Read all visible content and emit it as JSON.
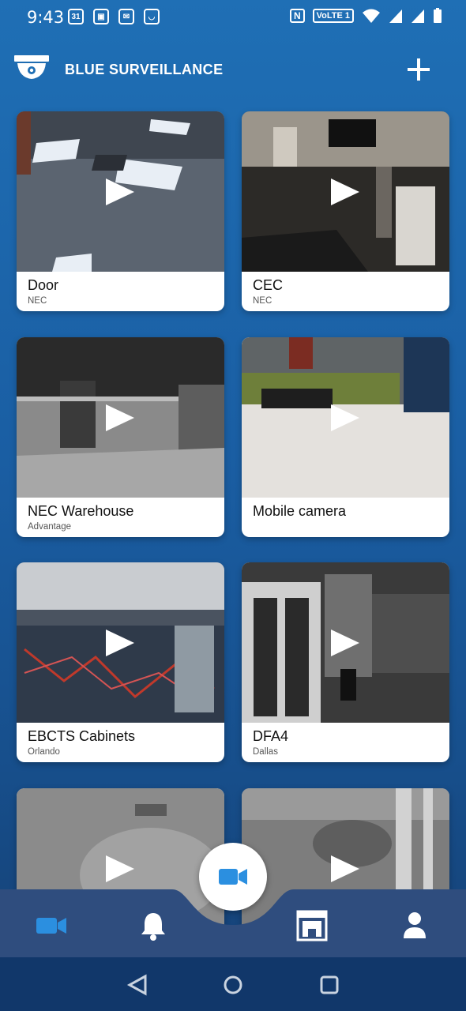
{
  "status_bar": {
    "time": "9:43",
    "calendar_day": "31",
    "volte_label": "VoLTE 1"
  },
  "header": {
    "app_title": "BLUE SURVEILLANCE",
    "logo_icon": "security-camera-icon",
    "add_icon": "plus-icon"
  },
  "cameras": [
    {
      "name": "Door",
      "location": "NEC"
    },
    {
      "name": "CEC",
      "location": "NEC"
    },
    {
      "name": "NEC Warehouse",
      "location": "Advantage"
    },
    {
      "name": "Mobile camera",
      "location": ""
    },
    {
      "name": "EBCTS Cabinets",
      "location": "Orlando"
    },
    {
      "name": "DFA4",
      "location": "Dallas"
    },
    {
      "name": "",
      "location": ""
    },
    {
      "name": "",
      "location": ""
    }
  ],
  "bottom_nav": {
    "items": [
      "video-camera-icon",
      "bell-icon",
      "recordings-icon",
      "user-icon"
    ],
    "fab_icon": "video-camera-icon",
    "active_color": "#2b8fe0"
  },
  "system_nav": [
    "back-icon",
    "home-icon",
    "recents-icon"
  ]
}
